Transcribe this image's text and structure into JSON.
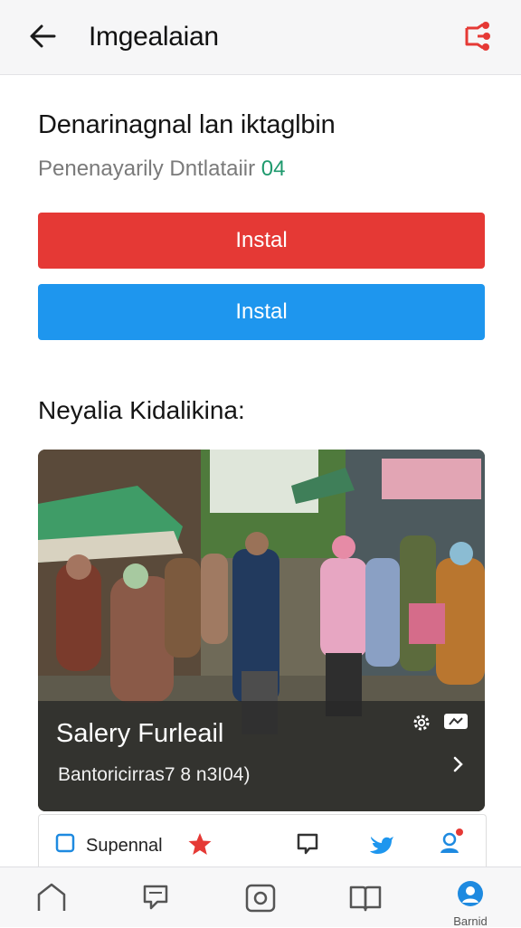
{
  "app_bar": {
    "title": "Imgealaian",
    "back_icon": "arrow-left-icon",
    "share_icon": "share-icon",
    "accent_color": "#e53935"
  },
  "content": {
    "heading": "Denarinagnal lan iktaglbin",
    "subheading_text": "Penenayarily Dntlataiir ",
    "subheading_accent": "04",
    "buttons": [
      {
        "label": "Instal",
        "color": "#e53935"
      },
      {
        "label": "Instal",
        "color": "#1e96ee"
      }
    ],
    "section_title": "Neyalia Kidalikina:"
  },
  "photo_card": {
    "title": "Salery Furleail",
    "subtitle": "Bantoricirras7 8 n3I04)",
    "icons": [
      "gear-icon",
      "video-badge-icon",
      "chevron-right-icon"
    ]
  },
  "action_bar": {
    "label": "Supennal",
    "icons": [
      "checkbox-icon",
      "star-icon",
      "comment-icon",
      "twitter-icon",
      "user-icon"
    ],
    "star_color": "#e53935",
    "twitter_color": "#1e96ee"
  },
  "bottom_nav": {
    "items": [
      {
        "icon": "home-icon"
      },
      {
        "icon": "chat-icon"
      },
      {
        "icon": "camera-icon"
      },
      {
        "icon": "book-icon"
      },
      {
        "icon": "account-icon",
        "label": "Barnid",
        "active_color": "#1e8ae0"
      }
    ]
  }
}
